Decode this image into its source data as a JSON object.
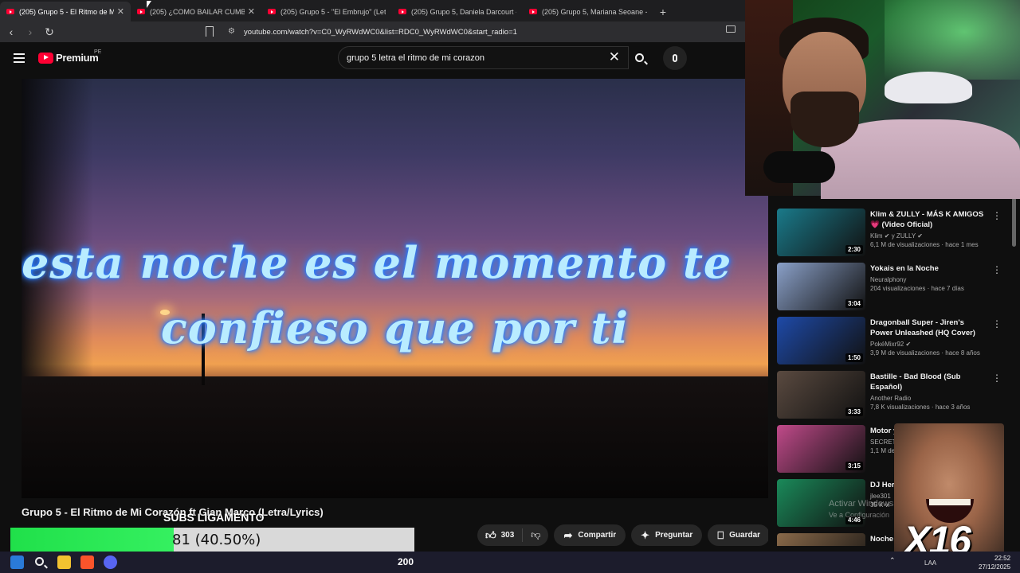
{
  "browser": {
    "tabs": [
      {
        "title": "(205) Grupo 5 - El Ritmo de Mi C",
        "active": true
      },
      {
        "title": "(205) ¿COMO BAILAR CUMBI",
        "active": false
      },
      {
        "title": "(205) Grupo 5 - \"El Embrujo\" (Letra)",
        "active": false
      },
      {
        "title": "(205) Grupo 5, Daniela Darcourt - Qu",
        "active": false
      },
      {
        "title": "(205) Grupo 5, Mariana Seoane - Alin",
        "active": false
      }
    ],
    "url": "youtube.com/watch?v=C0_WyRWdWC0&list=RDC0_WyRWdWC0&start_radio=1"
  },
  "header": {
    "brand": "Premium",
    "region": "PE",
    "search_value": "grupo 5 letra el ritmo de mi corazon"
  },
  "player": {
    "lyrics_line1": "esta noche es el momento te",
    "lyrics_line2": "confieso que por ti"
  },
  "video": {
    "title": "Grupo 5 - El Ritmo de Mi Corazón ft Gian Marco (Letra/Lyrics)",
    "likes": "303",
    "share_label": "Compartir",
    "ask_label": "Preguntar",
    "save_label": "Guardar"
  },
  "recommendations": [
    {
      "title": "Klim & ZULLY - MÁS K AMIGOS 💗 (Video Oficial)",
      "channel": "Klim ✔ y ZULLY ✔",
      "meta": "6,1 M de visualizaciones · hace 1 mes",
      "duration": "2:30",
      "thumb": "#1a7a8a"
    },
    {
      "title": "Yokais en la Noche",
      "channel": "Neuralphony",
      "meta": "204 visualizaciones · hace 7 días",
      "duration": "3:04",
      "thumb": "#8aa0c8"
    },
    {
      "title": "Dragonball Super - Jiren's Power Unleashed (HQ Cover)",
      "channel": "PokéMixr92 ✔",
      "meta": "3,9 M de visualizaciones · hace 8 años",
      "duration": "1:50",
      "thumb": "#1e4aa8"
    },
    {
      "title": "Bastille - Bad Blood (Sub Español)",
      "channel": "Another Radio",
      "meta": "7,8 K visualizaciones · hace 3 años",
      "duration": "3:33",
      "thumb": "#5a4a40"
    },
    {
      "title": "Motor y",
      "channel": "SECRET",
      "meta": "1,1 M de",
      "duration": "3:15",
      "thumb": "#c04a8a"
    },
    {
      "title": "DJ Her",
      "channel": "jlee301",
      "meta": "35 K vi",
      "duration": "4:46",
      "thumb": "#1a8a5a"
    },
    {
      "title": "Noche De B",
      "channel": "",
      "meta": "",
      "duration": "",
      "thumb": "#8a6a4a"
    }
  ],
  "overlay": {
    "subs_title": "SUBS LIGAMENTO",
    "goal_text": "81 (40.50%)",
    "goal_progress": 0.405,
    "meme_label": "X16",
    "taskbar_counter": "200",
    "watermark_1": "Activar Windows",
    "watermark_2": "Ve a Configuración"
  },
  "system": {
    "lang": "LAA",
    "time": "22:52",
    "date": "27/12/2025"
  }
}
